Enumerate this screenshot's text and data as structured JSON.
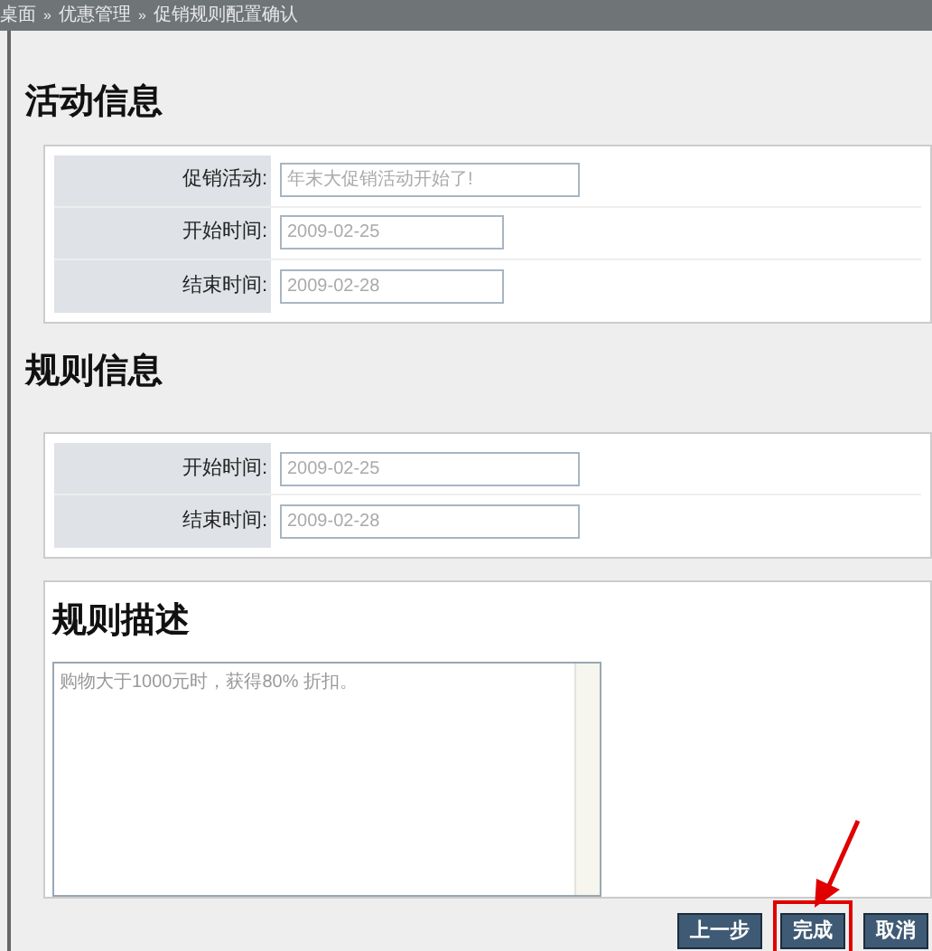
{
  "breadcrumb": [
    "桌面",
    "优惠管理",
    "促销规则配置确认"
  ],
  "breadcrumb_separator": "»",
  "activity_section": {
    "title": "活动信息",
    "fields": [
      {
        "label": "促销活动:",
        "value": "年末大促销活动开始了!",
        "wide": true
      },
      {
        "label": "开始时间:",
        "value": "2009-02-25",
        "wide": false
      },
      {
        "label": "结束时间:",
        "value": "2009-02-28",
        "wide": false
      }
    ]
  },
  "rule_section": {
    "title": "规则信息",
    "fields": [
      {
        "label": "开始时间:",
        "value": "2009-02-25",
        "wide": true
      },
      {
        "label": "结束时间:",
        "value": "2009-02-28",
        "wide": true
      }
    ]
  },
  "description_section": {
    "title": "规则描述",
    "value": "购物大于1000元时，获得80% 折扣。"
  },
  "buttons": [
    {
      "label": "上一步",
      "highlighted": false
    },
    {
      "label": "完成",
      "highlighted": true
    },
    {
      "label": "取消",
      "highlighted": false
    }
  ]
}
